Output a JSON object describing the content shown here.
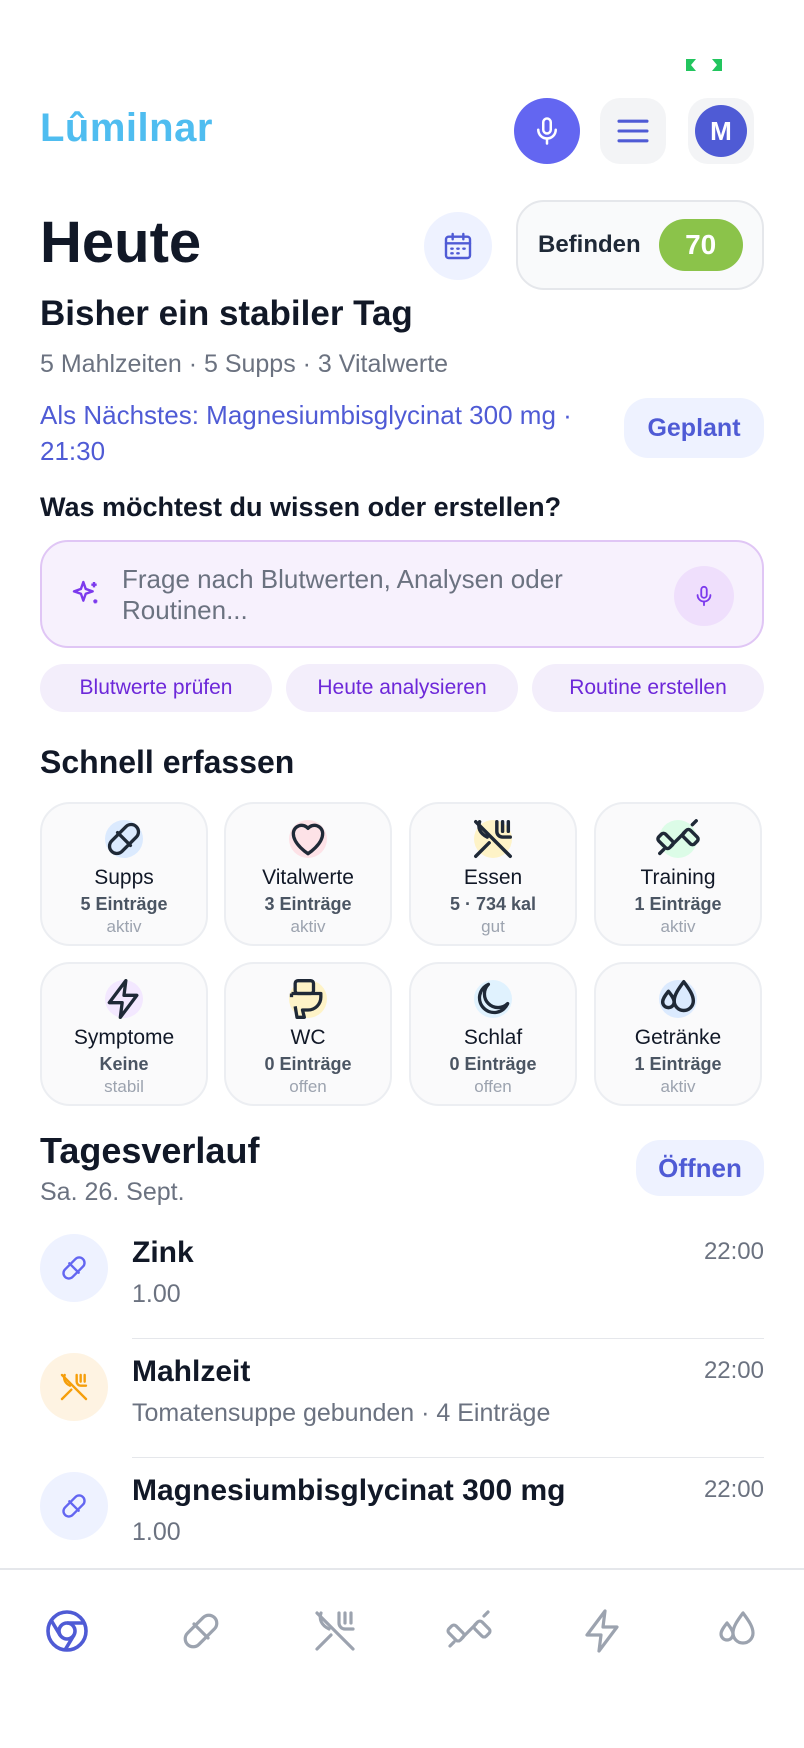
{
  "app": {
    "name": "Lûmilnar",
    "avatar_initial": "M"
  },
  "header": {
    "title": "Heute",
    "mood_label": "Befinden",
    "mood_score": "70"
  },
  "day": {
    "headline": "Bisher ein stabiler Tag",
    "summary": "5 Mahlzeiten · 5 Supps · 3 Vitalwerte",
    "next": "Als Nächstes: Magnesiumbisglycinat 300 mg · 21:30",
    "planned_label": "Geplant"
  },
  "ask": {
    "question": "Was möchtest du wissen oder erstellen?",
    "placeholder": "Frage nach Blutwerten, Analysen oder Routinen...",
    "chips": [
      "Blutwerte prüfen",
      "Heute analysieren",
      "Routine erstellen"
    ]
  },
  "quick": {
    "title": "Schnell erfassen",
    "tiles": [
      {
        "icon": "pill-icon",
        "title": "Supps",
        "count": "5 Einträge",
        "state": "aktiv"
      },
      {
        "icon": "heart-icon",
        "title": "Vitalwerte",
        "count": "3 Einträge",
        "state": "aktiv"
      },
      {
        "icon": "utensils-icon",
        "title": "Essen",
        "count": "5 · 734 kal",
        "state": "gut"
      },
      {
        "icon": "dumbbell-icon",
        "title": "Training",
        "count": "1 Einträge",
        "state": "aktiv"
      },
      {
        "icon": "lightning-icon",
        "title": "Symptome",
        "count": "Keine",
        "state": "stabil"
      },
      {
        "icon": "toilet-icon",
        "title": "WC",
        "count": "0 Einträge",
        "state": "offen"
      },
      {
        "icon": "moon-icon",
        "title": "Schlaf",
        "count": "0 Einträge",
        "state": "offen"
      },
      {
        "icon": "droplets-icon",
        "title": "Getränke",
        "count": "1 Einträge",
        "state": "aktiv"
      }
    ]
  },
  "timeline": {
    "title": "Tagesverlauf",
    "date": "Sa. 26. Sept.",
    "open_label": "Öffnen",
    "items": [
      {
        "icon": "pill-icon",
        "title": "Zink",
        "sub": "1.00",
        "time": "22:00"
      },
      {
        "icon": "utensils-icon",
        "title": "Mahlzeit",
        "sub": "Tomatensuppe gebunden · 4 Einträge",
        "time": "22:00"
      },
      {
        "icon": "pill-icon",
        "title": "Magnesiumbisglycinat 300 mg",
        "sub": "1.00",
        "time": "22:00"
      }
    ]
  },
  "nav": [
    "home-icon",
    "pill-icon",
    "utensils-icon",
    "dumbbell-icon",
    "lightning-icon",
    "droplets-icon"
  ],
  "colors": {
    "brand": "#4fbdf0",
    "accent": "#6366f1",
    "mood": "#8bc34a",
    "chip_text": "#6d28d9"
  }
}
